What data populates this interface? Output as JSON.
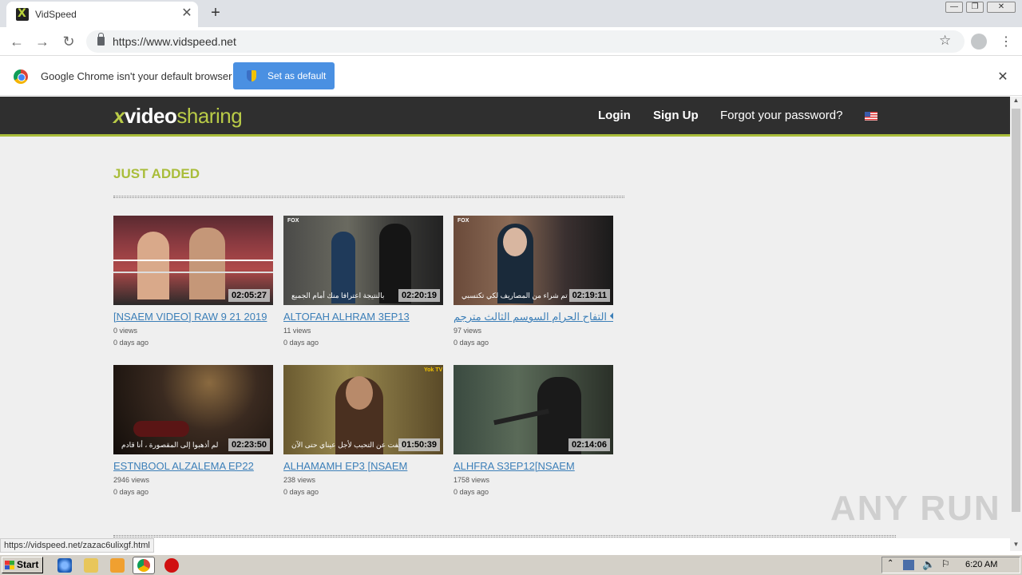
{
  "browser": {
    "tab_title": "VidSpeed",
    "tab_close": "✕",
    "new_tab": "+",
    "url": "https://www.vidspeed.net",
    "window_controls": [
      "—",
      "❐",
      "✕"
    ],
    "status_url": "https://vidspeed.net/zazac6ulixgf.html"
  },
  "infobar": {
    "message": "Google Chrome isn't your default browser",
    "button": "Set as default",
    "close": "✕"
  },
  "site": {
    "logo": {
      "x": "x",
      "video": "video",
      "sharing": "sharing"
    },
    "nav": {
      "login": "Login",
      "signup": "Sign Up",
      "forgot": "Forgot your password?"
    },
    "section_title": "JUST ADDED",
    "videos": [
      {
        "title": "[NSAEM VIDEO] RAW 9 21 2019",
        "duration": "02:05:27",
        "views": "0 views",
        "date": "0 days ago",
        "subtitle": "",
        "channel": ""
      },
      {
        "title": "ALTOFAH ALHRAM 3EP13",
        "duration": "02:20:19",
        "views": "11 views",
        "date": "0 days ago",
        "subtitle": "بالنتيجة اعترافا منك أمام الجميع",
        "channel": "FOX"
      },
      {
        "title": "التفاح الحرام السوسم الثالث مترجم �...",
        "duration": "02:19:11",
        "views": "97 views",
        "date": "0 days ago",
        "subtitle": "تم شراء من المصاريف لكي تكتسبي",
        "channel": "FOX"
      },
      {
        "title": "ESTNBOOL ALZALEMA EP22",
        "duration": "02:23:50",
        "views": "2946 views",
        "date": "0 days ago",
        "subtitle": "لم أذهبوا إلى المقصورة ، أنا قادم",
        "channel": ""
      },
      {
        "title": "ALHAMAMH EP3 [NSAEM",
        "duration": "01:50:39",
        "views": "238 views",
        "date": "0 days ago",
        "subtitle": "توقفت عن التحبب لأجل عيناي حتى الآن",
        "channel": "Yok TV"
      },
      {
        "title": "ALHFRA S3EP12[NSAEM",
        "duration": "02:14:06",
        "views": "1758 views",
        "date": "0 days ago",
        "subtitle": "",
        "channel": ""
      }
    ]
  },
  "watermark": "ANY RUN",
  "taskbar": {
    "start": "Start",
    "clock": "6:20 AM"
  },
  "colors": {
    "accent": "#a9bd3a",
    "link": "#3c7fb8",
    "header_bg": "#2f2f2f",
    "button_blue": "#4a90e2"
  }
}
